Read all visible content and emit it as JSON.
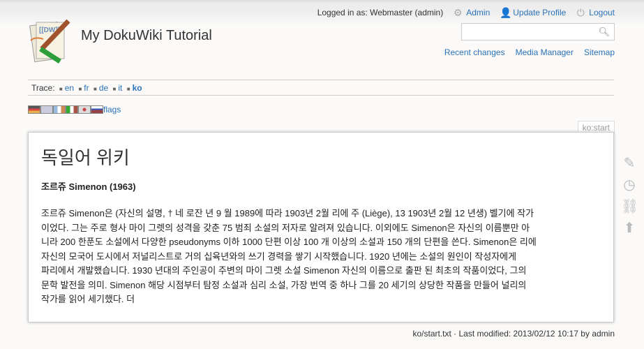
{
  "site": {
    "title": "My DokuWiki Tutorial",
    "logo_text": "[[DW]]"
  },
  "user": {
    "logged_in": "Logged in as: Webmaster (admin)",
    "admin": "Admin",
    "profile": "Update Profile",
    "logout": "Logout"
  },
  "search": {
    "value": "",
    "placeholder": ""
  },
  "nav": {
    "recent": "Recent changes",
    "media": "Media Manager",
    "sitemap": "Sitemap"
  },
  "trace": {
    "label": "Trace:",
    "items": [
      "en",
      "fr",
      "de",
      "it",
      "ko"
    ]
  },
  "flags": {
    "label": "flags"
  },
  "page": {
    "id": "ko:start",
    "heading": "독일어 위키",
    "subheading": "조르쥬 Simenon (1963)",
    "lines": [
      "조르쥬 Simenon은 (자신의 설명, † 네 로잔 년 9 월 1989에 따라 1903년 2월 리에 주 (Liège), 13 1903년 2월 12 년생) 벨기에 작가",
      "이었다. 그는 주로 형사 마이 그렛의 성격을 갖춘 75 범죄 소설의 저자로 알려져 있습니다. 이외에도 Simenon은 자신의 이름뿐만 아",
      "니라 200 한푼도 소설에서 다양한 pseudonyms 이하 1000 단편 이상 100 개 이상의 소설과 150 개의 단편을 쓴다. Simenon은 리에",
      "자신의 모국어 도시에서 저널리스트로 거의 십육년와의 쓰기 경력을 쌓기 시작했습니다. 1920 년에는 소설의 원인이 작성자에게",
      "파리에서 개발했습니다. 1930 년대의 주인공이 주변의 마이 그렛 소설 Simenon 자신의 이름으로 출판 된 최초의 작품이었다, 그의",
      "문학 발전을 의미. Simenon 해당 시점부터 탐정 소설과 심리 소설, 가장 번역 중 하나 그를 20 세기의 상당한 작품을 만들어 널리의",
      "작가를 읽어 세기했다. 더"
    ]
  },
  "footer": {
    "file": "ko/start.txt",
    "modified": " · Last modified: 2013/02/12 10:17 by admin"
  }
}
